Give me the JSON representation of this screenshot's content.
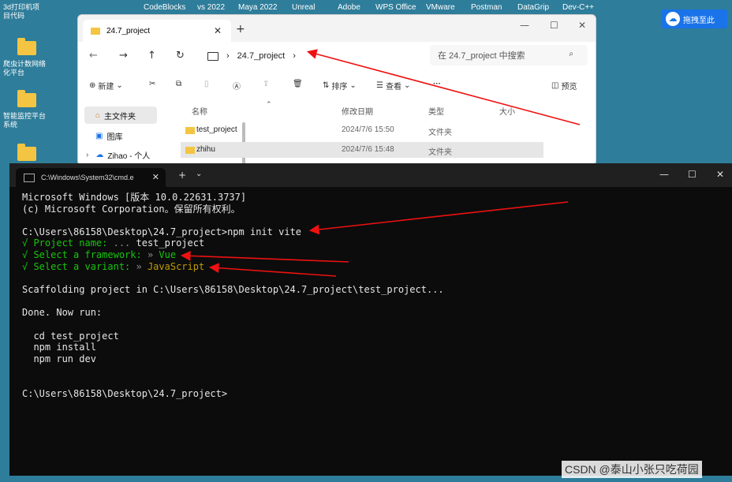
{
  "taskbar": {
    "items": [
      "CodeBlocks",
      "vs 2022",
      "Maya 2022",
      "Unreal",
      "Adobe",
      "WPS Office",
      "VMware",
      "Postman",
      "DataGrip",
      "Dev-C++"
    ]
  },
  "desktop": {
    "left_labels": [
      "3d打印机项\n目代码",
      "爬虫计数网络\n化平台",
      "智能监控平台\n系统"
    ],
    "right_app": "拖拽至此"
  },
  "explorer": {
    "tab_title": "24.7_project",
    "breadcrumb": "24.7_project",
    "search_placeholder": "在 24.7_project 中搜索",
    "toolbar": {
      "new": "新建",
      "sort": "排序",
      "view": "查看",
      "more": "···",
      "preview": "预览"
    },
    "sidebar": [
      {
        "label": "主文件夹"
      },
      {
        "label": "图库"
      },
      {
        "label": "Zihao - 个人"
      }
    ],
    "columns": {
      "name": "名称",
      "date": "修改日期",
      "type": "类型",
      "size": "大小"
    },
    "rows": [
      {
        "name": "test_project",
        "date": "2024/7/6 15:50",
        "type": "文件夹"
      },
      {
        "name": "zhihu",
        "date": "2024/7/6 15:48",
        "type": "文件夹"
      }
    ]
  },
  "cmd": {
    "tab_title": "C:\\Windows\\System32\\cmd.e",
    "lines": {
      "l1": "Microsoft Windows [版本 10.0.22631.3737]",
      "l2": "(c) Microsoft Corporation。保留所有权利。",
      "l3": "C:\\Users\\86158\\Desktop\\24.7_project>npm init vite",
      "l4_prefix": "√ Project name: ",
      "l4_dots": "...",
      "l4_val": " test_project",
      "l5_prefix": "√ Select a framework: ",
      "l5_sep": "»",
      "l5_val": " Vue",
      "l6_prefix": "√ Select a variant: ",
      "l6_sep": "»",
      "l6_val": " JavaScript",
      "l7": "Scaffolding project in C:\\Users\\86158\\Desktop\\24.7_project\\test_project...",
      "l8": "Done. Now run:",
      "l9": "  cd test_project",
      "l10": "  npm install",
      "l11": "  npm run dev",
      "l12": "C:\\Users\\86158\\Desktop\\24.7_project>"
    }
  },
  "watermark": "CSDN @泰山小张只吃荷园"
}
